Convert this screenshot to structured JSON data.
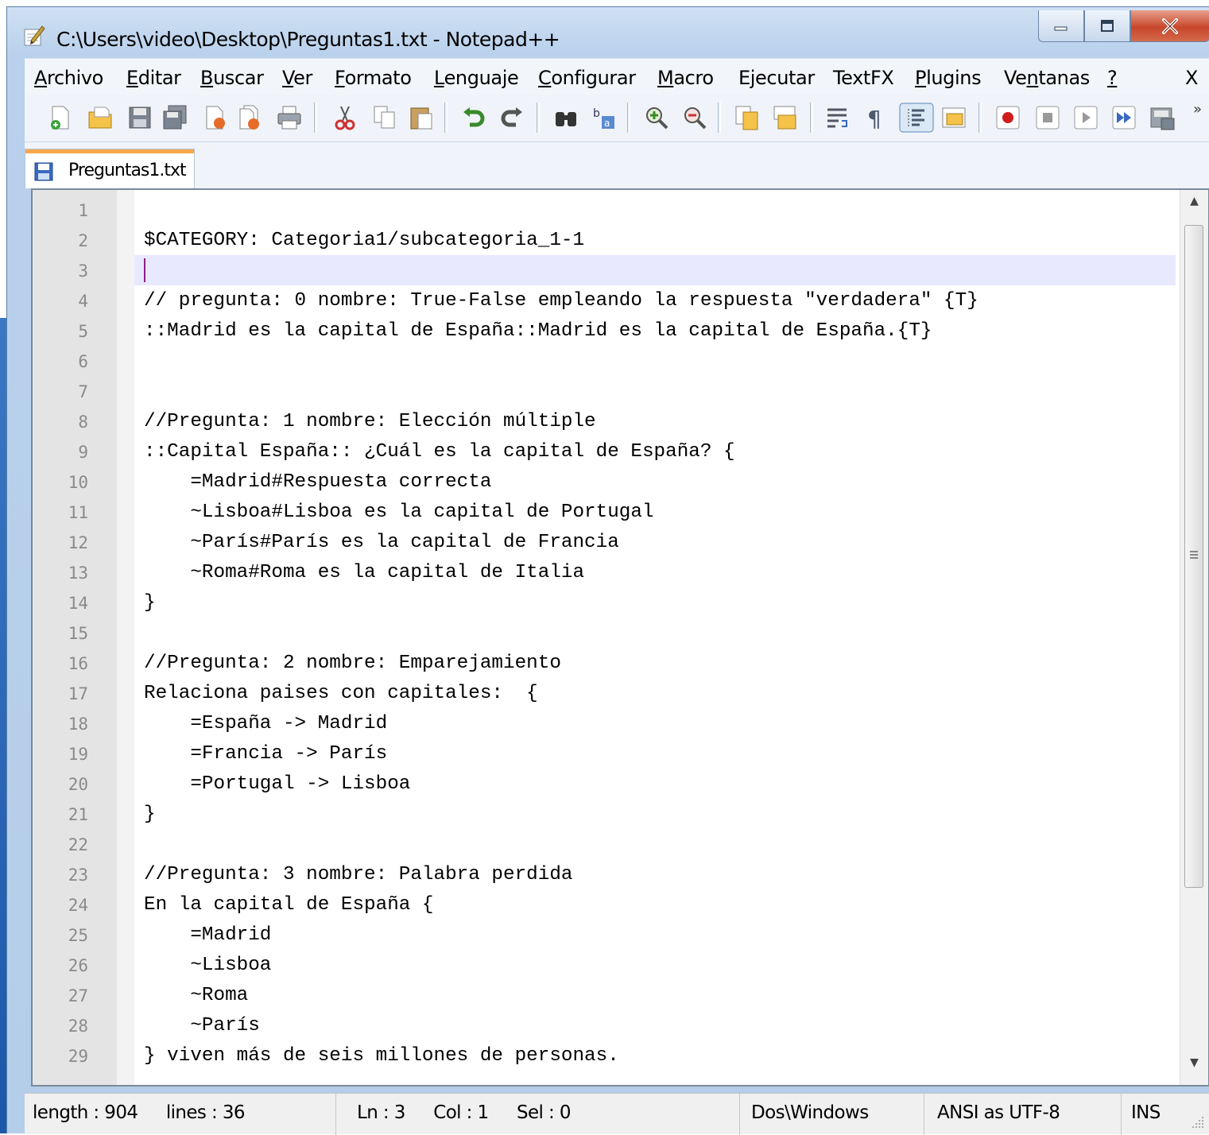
{
  "window": {
    "title": "C:\\Users\\video\\Desktop\\Preguntas1.txt - Notepad++",
    "minimize_label": "—",
    "maximize_label": "□",
    "close_label": "X"
  },
  "menu": {
    "items": [
      {
        "pre": "",
        "u": "A",
        "post": "rchivo"
      },
      {
        "pre": "",
        "u": "E",
        "post": "ditar"
      },
      {
        "pre": "",
        "u": "B",
        "post": "uscar"
      },
      {
        "pre": "",
        "u": "V",
        "post": "er"
      },
      {
        "pre": "",
        "u": "F",
        "post": "ormato"
      },
      {
        "pre": "",
        "u": "L",
        "post": "enguaje"
      },
      {
        "pre": "",
        "u": "C",
        "post": "onfigurar"
      },
      {
        "pre": "",
        "u": "M",
        "post": "acro"
      },
      {
        "pre": "E",
        "u": "j",
        "post": "ecutar"
      },
      {
        "pre": "TextFX",
        "u": "",
        "post": ""
      },
      {
        "pre": "",
        "u": "P",
        "post": "lugins"
      },
      {
        "pre": "Ve",
        "u": "n",
        "post": "tanas"
      },
      {
        "pre": "",
        "u": "?",
        "post": ""
      }
    ],
    "close_doc": "X"
  },
  "toolbar": {
    "icons": [
      "new-file-icon",
      "open-file-icon",
      "save-icon",
      "save-all-icon",
      "close-icon",
      "close-all-icon",
      "print-icon",
      "cut-icon",
      "copy-icon",
      "paste-icon",
      "undo-icon",
      "redo-icon",
      "find-icon",
      "replace-icon",
      "zoom-in-icon",
      "zoom-out-icon",
      "sync-vertical-icon",
      "sync-horizontal-icon",
      "word-wrap-icon",
      "show-all-chars-icon",
      "indent-guide-icon",
      "doc-map-icon",
      "record-macro-icon",
      "stop-macro-icon",
      "play-macro-icon",
      "run-macro-multiple-icon",
      "save-macro-icon"
    ],
    "overflow": "»"
  },
  "tab": {
    "label": "Preguntas1.txt"
  },
  "editor": {
    "current_line": 3,
    "lines": [
      "",
      "$CATEGORY: Categoria1/subcategoria_1-1",
      "",
      "// pregunta: 0 nombre: True-False empleando la respuesta \"verdadera\" {T}",
      "::Madrid es la capital de España::Madrid es la capital de España.{T}",
      "",
      "",
      "//Pregunta: 1 nombre: Elección múltiple",
      "::Capital España:: ¿Cuál es la capital de España? {",
      "    =Madrid#Respuesta correcta",
      "    ~Lisboa#Lisboa es la capital de Portugal",
      "    ~París#París es la capital de Francia",
      "    ~Roma#Roma es la capital de Italia",
      "}",
      "",
      "//Pregunta: 2 nombre: Emparejamiento",
      "Relaciona paises con capitales:  {",
      "    =España -> Madrid",
      "    =Francia -> París",
      "    =Portugal -> Lisboa",
      "}",
      "",
      "//Pregunta: 3 nombre: Palabra perdida",
      "En la capital de España {",
      "    =Madrid",
      "    ~Lisboa",
      "    ~Roma",
      "    ~París",
      "} viven más de seis millones de personas."
    ]
  },
  "status": {
    "length": "length : 904",
    "lines": "lines : 36",
    "ln": "Ln : 3",
    "col": "Col : 1",
    "sel": "Sel : 0",
    "eol": "Dos\\Windows",
    "encoding": "ANSI as UTF-8",
    "mode": "INS"
  }
}
